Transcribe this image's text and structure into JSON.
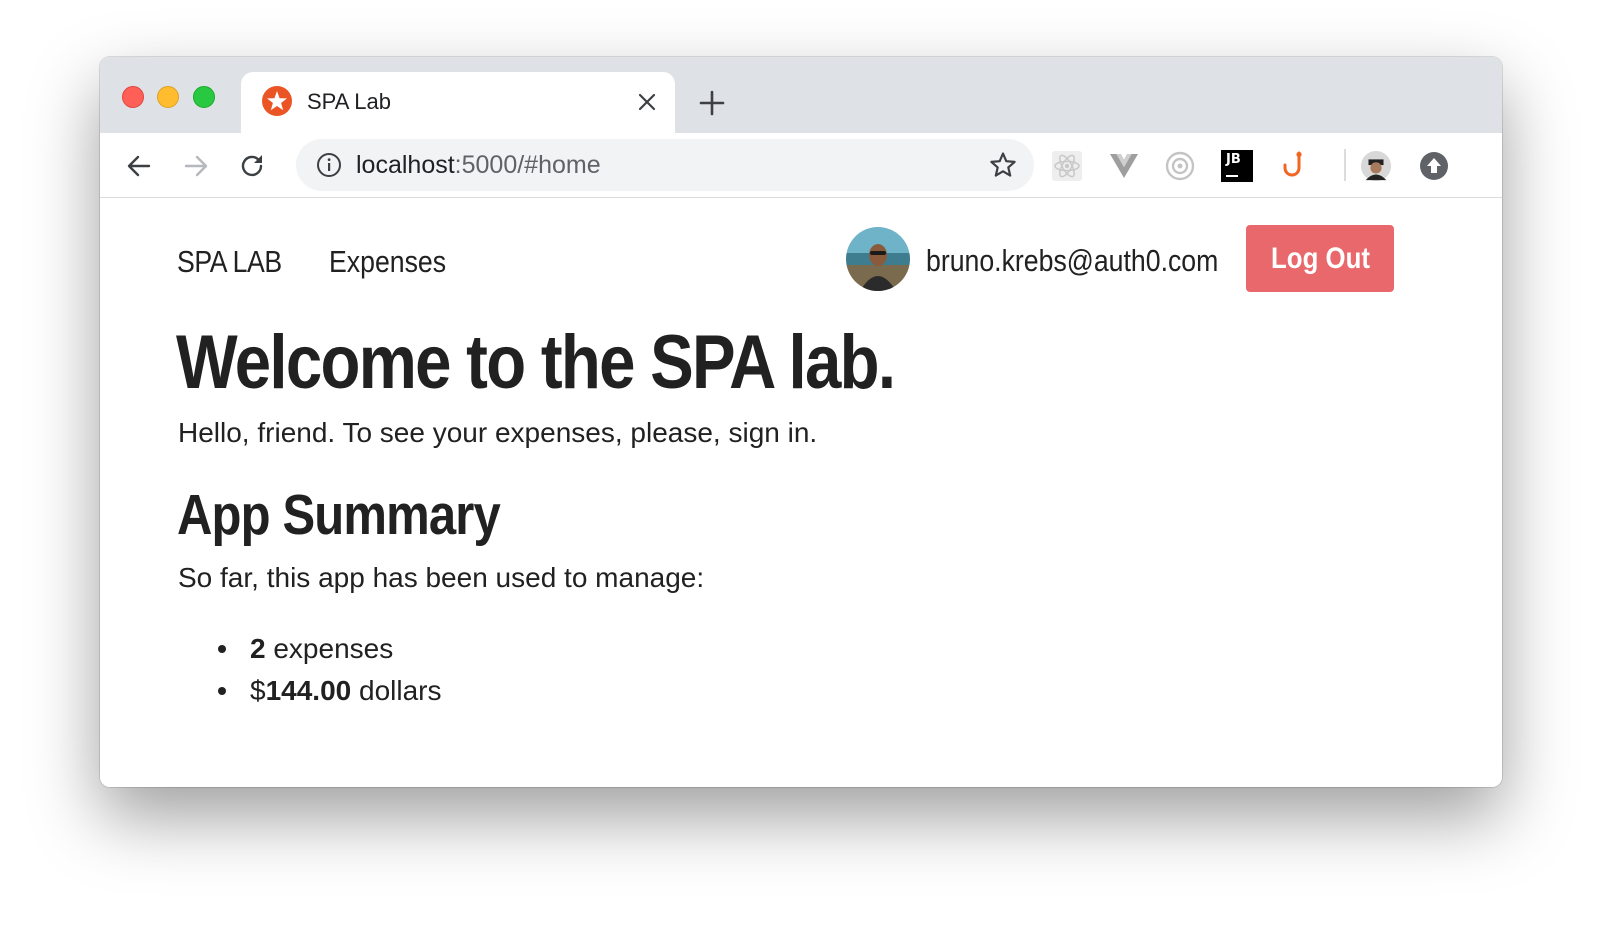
{
  "browser": {
    "tab_title": "SPA Lab",
    "url_host": "localhost",
    "url_rest": ":5000/#home",
    "extensions": [
      "react-devtools-icon",
      "vue-devtools-icon",
      "capture-icon",
      "jetbrains-icon",
      "hook-icon",
      "profile-avatar-icon",
      "update-icon"
    ],
    "extension_label_jb": "JB"
  },
  "navbar": {
    "brand": "SPA LAB",
    "link_expenses": "Expenses",
    "user_email": "bruno.krebs@auth0.com",
    "logout_label": "Log Out"
  },
  "main": {
    "title": "Welcome to the SPA lab.",
    "lead": "Hello, friend. To see your expenses, please, sign in.",
    "summary_heading": "App Summary",
    "summary_intro": "So far, this app has been used to manage:",
    "stats": [
      {
        "value": "2",
        "label": " expenses"
      },
      {
        "prefix": "$",
        "value": "144.00",
        "label": " dollars"
      }
    ]
  },
  "colors": {
    "logout_bg": "#e8686b",
    "favicon": "#eb5424"
  }
}
